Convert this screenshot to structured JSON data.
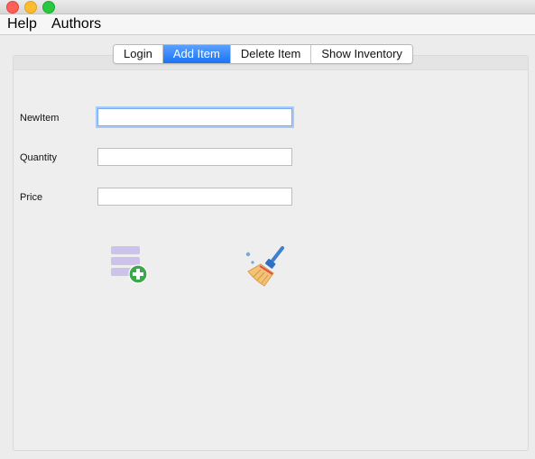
{
  "menu": {
    "help": "Help",
    "authors": "Authors"
  },
  "tabs": [
    {
      "label": "Login",
      "active": false
    },
    {
      "label": "Add Item",
      "active": true
    },
    {
      "label": "Delete Item",
      "active": false
    },
    {
      "label": "Show Inventory",
      "active": false
    }
  ],
  "form": {
    "new_item": {
      "label": "NewItem",
      "value": "",
      "placeholder": ""
    },
    "quantity": {
      "label": "Quantity",
      "value": "",
      "placeholder": ""
    },
    "price": {
      "label": "Price",
      "value": "",
      "placeholder": ""
    }
  },
  "icons": {
    "add": "add-to-list-icon",
    "clear": "broom-icon"
  },
  "colors": {
    "active_tab": "#1a72f5",
    "add_icon_green": "#3aa84b",
    "list_icon_purple": "#c9bfe8"
  }
}
